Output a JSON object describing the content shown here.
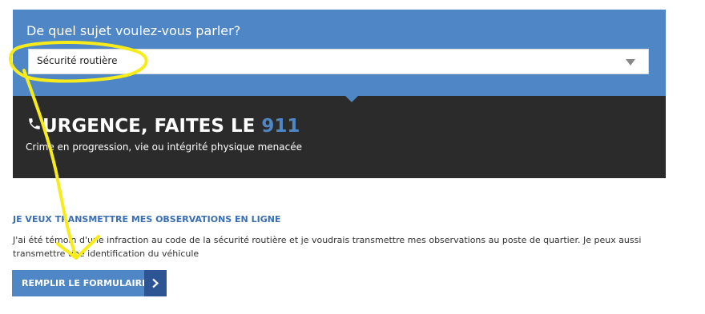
{
  "topic": {
    "label": "De quel sujet voulez-vous parler?",
    "selected": "Sécurité routière"
  },
  "emergency": {
    "title": "URGENCE, FAITES LE ",
    "number": "911",
    "subtitle": "Crime en progression, vie ou intégrité physique menacée"
  },
  "online": {
    "heading": "JE VEUX TRANSMETTRE MES OBSERVATIONS EN LIGNE",
    "body": "J'ai été témoin d'une infraction au code de la sécurité routière et je voudrais transmettre mes observations au poste de quartier. Je peux aussi transmettre une identification du véhicule",
    "button_label": "REMPLIR LE FORMULAIRE"
  },
  "icons": {
    "phone": "phone-icon",
    "select_arrow": "chevron-down-icon",
    "button_arrow": "chevron-right-icon"
  },
  "colors": {
    "brand_blue": "#4f86c6",
    "dark_blue": "#2e5593",
    "panel_dark": "#2b2b2b",
    "annotation_yellow": "#f7ec1a"
  }
}
